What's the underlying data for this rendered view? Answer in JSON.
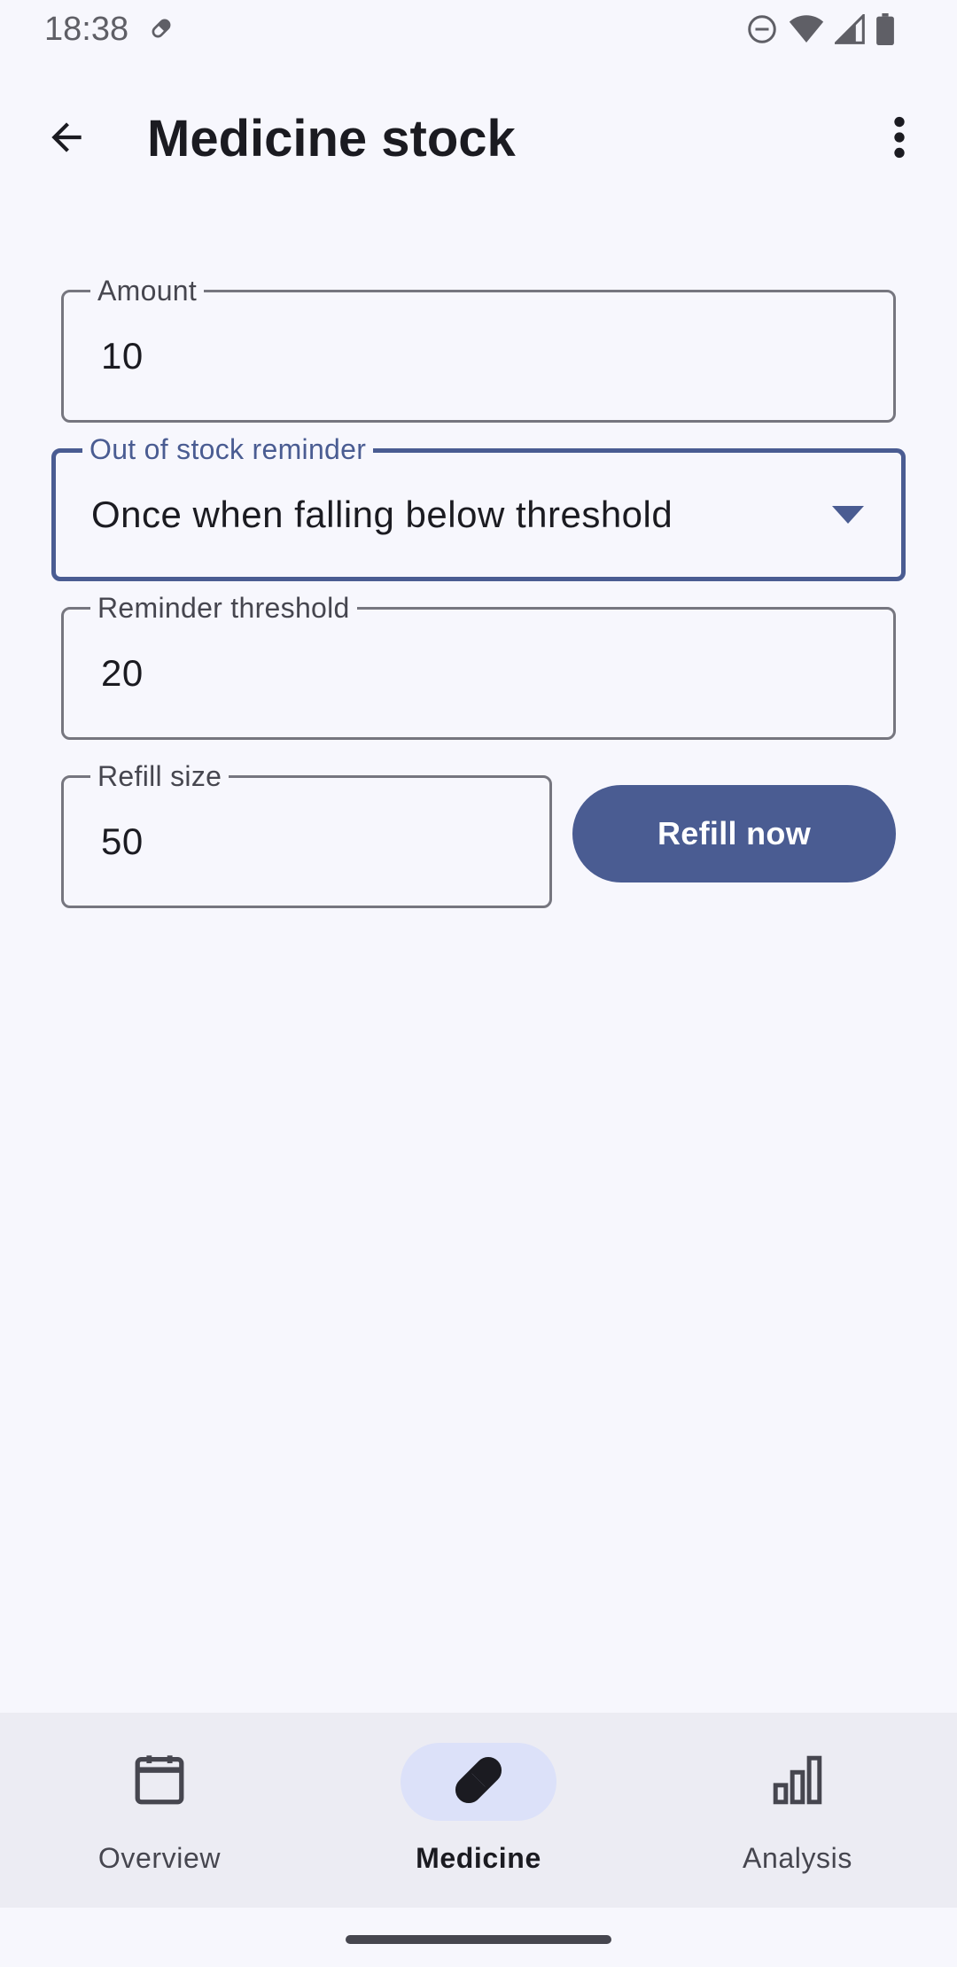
{
  "status_bar": {
    "time": "18:38",
    "left_icon": "pill-notification-icon",
    "right_icons": [
      "do-not-disturb-icon",
      "wifi-icon",
      "cellular-signal-icon",
      "battery-icon"
    ]
  },
  "app_bar": {
    "title": "Medicine stock",
    "back_icon": "arrow-back-icon",
    "menu_icon": "more-vert-icon"
  },
  "form": {
    "amount": {
      "label": "Amount",
      "value": "10"
    },
    "reminder": {
      "label": "Out of stock reminder",
      "value": "Once when falling below threshold"
    },
    "threshold": {
      "label": "Reminder threshold",
      "value": "20"
    },
    "refill_size": {
      "label": "Refill size",
      "value": "50"
    },
    "refill_button": "Refill now"
  },
  "bottom_nav": {
    "items": [
      {
        "label": "Overview",
        "icon": "calendar-icon",
        "active": false
      },
      {
        "label": "Medicine",
        "icon": "pill-icon",
        "active": true
      },
      {
        "label": "Analysis",
        "icon": "bar-chart-icon",
        "active": false
      }
    ]
  },
  "colors": {
    "background": "#F7F7FD",
    "primary": "#4A5C92",
    "outline": "#76767F",
    "nav_background": "#ECECF3",
    "active_indicator": "#DCE1F9"
  }
}
